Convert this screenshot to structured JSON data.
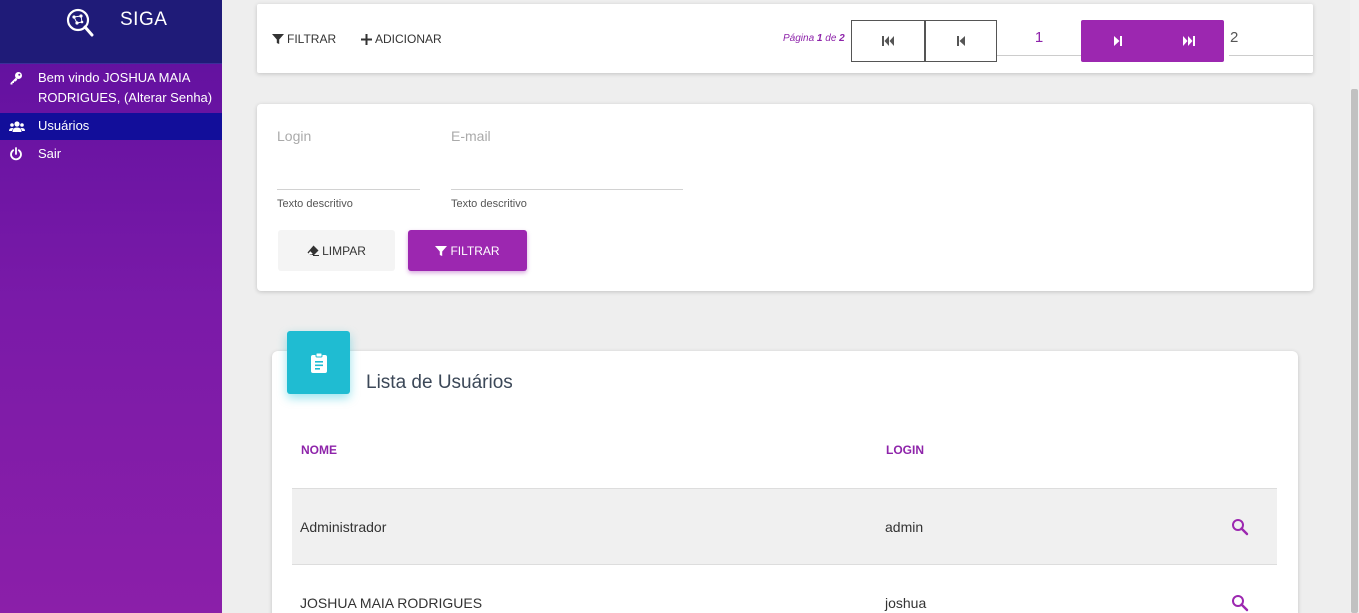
{
  "sidebar": {
    "app_name": "SIGA",
    "welcome_line1": "Bem vindo JOSHUA MAIA",
    "welcome_line2": "RODRIGUES, (Alterar Senha)",
    "users_label": "Usuários",
    "exit_label": "Sair",
    "logo_icon": "search-network-logo-icon",
    "welcome_icon": "key-icon",
    "users_icon": "users-icon",
    "exit_icon": "power-icon",
    "active_bg": "#120e9a"
  },
  "toolbar": {
    "filter_label": "FILTRAR",
    "add_label": "ADICIONAR",
    "page_prefix": "Página",
    "page_current": "1",
    "page_sep": "de",
    "page_total": "2",
    "current_page_value": "1",
    "total_pages_value": "2"
  },
  "filters": {
    "login_label": "Login",
    "login_help": "Texto descritivo",
    "email_label": "E-mail",
    "email_help": "Texto descritivo",
    "clear_label": "LIMPAR",
    "filter_label": "FILTRAR"
  },
  "list": {
    "title": "Lista de Usuários",
    "columns": [
      "NOME",
      "LOGIN"
    ],
    "rows": [
      {
        "name": "Administrador",
        "login": "admin"
      },
      {
        "name": "JOSHUA MAIA RODRIGUES",
        "login": "joshua"
      }
    ]
  },
  "colors": {
    "accent": "#9c27b0",
    "brand_header": "#1f1b78",
    "card_icon": "#1fbcd2"
  }
}
